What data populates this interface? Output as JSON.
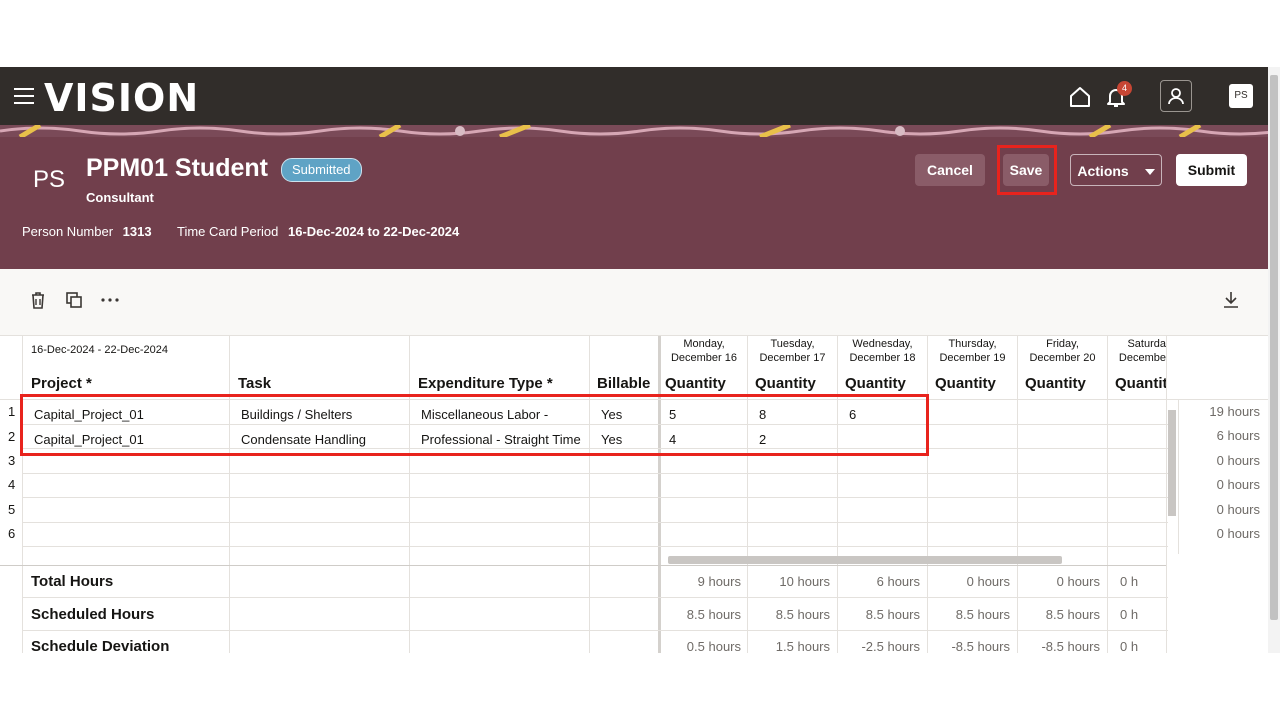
{
  "app": {
    "logo_text": "VISION",
    "notification_count": "4",
    "avatar_initials": "PS"
  },
  "header": {
    "initials": "PS",
    "name": "PPM01 Student",
    "status": "Submitted",
    "role": "Consultant",
    "person_number_label": "Person Number",
    "person_number": "1313",
    "period_label": "Time Card Period",
    "period": "16-Dec-2024 to 22-Dec-2024",
    "buttons": {
      "cancel": "Cancel",
      "save": "Save",
      "actions": "Actions",
      "submit": "Submit"
    }
  },
  "grid": {
    "date_range": "16-Dec-2024 - 22-Dec-2024",
    "columns": {
      "project": "Project *",
      "task": "Task",
      "expenditure": "Expenditure Type *",
      "billable": "Billable"
    },
    "days": [
      {
        "line1": "Monday,",
        "line2": "December 16",
        "header": "Quantity"
      },
      {
        "line1": "Tuesday,",
        "line2": "December 17",
        "header": "Quantity"
      },
      {
        "line1": "Wednesday,",
        "line2": "December 18",
        "header": "Quantity"
      },
      {
        "line1": "Thursday,",
        "line2": "December 19",
        "header": "Quantity"
      },
      {
        "line1": "Friday,",
        "line2": "December 20",
        "header": "Quantity"
      },
      {
        "line1": "Saturda",
        "line2": "Decembe",
        "header": "Quantit"
      }
    ],
    "rows": [
      {
        "num": "1",
        "project": "Capital_Project_01",
        "task": "Buildings / Shelters",
        "expenditure": "Miscellaneous Labor -",
        "billable": "Yes",
        "q": [
          "5",
          "8",
          "6",
          "",
          "",
          ""
        ],
        "total": "19 hours"
      },
      {
        "num": "2",
        "project": "Capital_Project_01",
        "task": "Condensate Handling",
        "expenditure": "Professional - Straight Time",
        "billable": "Yes",
        "q": [
          "4",
          "2",
          "",
          "",
          "",
          ""
        ],
        "total": "6 hours"
      },
      {
        "num": "3",
        "total": "0 hours"
      },
      {
        "num": "4",
        "total": "0 hours"
      },
      {
        "num": "5",
        "total": "0 hours"
      },
      {
        "num": "6",
        "total": "0 hours"
      }
    ],
    "summary": [
      {
        "label": "Total Hours",
        "values": [
          "9 hours",
          "10 hours",
          "6 hours",
          "0 hours",
          "0 hours",
          "0 h"
        ]
      },
      {
        "label": "Scheduled Hours",
        "values": [
          "8.5 hours",
          "8.5 hours",
          "8.5 hours",
          "8.5 hours",
          "8.5 hours",
          "0 h"
        ]
      },
      {
        "label": "Schedule Deviation",
        "values": [
          "0.5 hours",
          "1.5 hours",
          "-2.5 hours",
          "-8.5 hours",
          "-8.5 hours",
          "0 h"
        ]
      }
    ]
  },
  "colors": {
    "nav": "#312d2a",
    "header": "#713f4c",
    "highlight": "#e8231d",
    "badge": "#5fa3c5"
  }
}
